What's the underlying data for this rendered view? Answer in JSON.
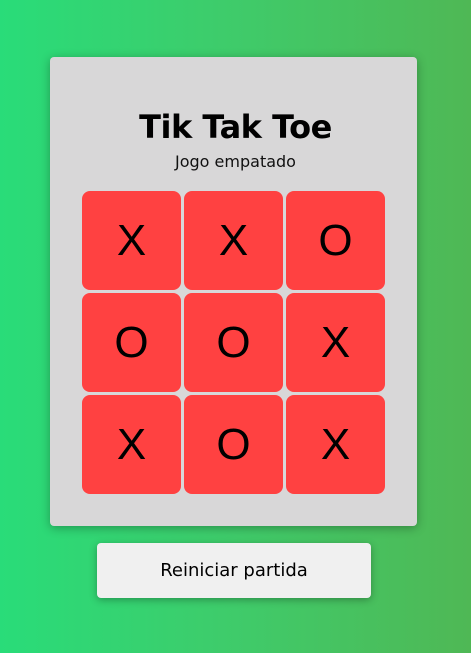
{
  "title": "Tik Tak Toe",
  "status": "Jogo empatado",
  "board": [
    "X",
    "X",
    "O",
    "O",
    "O",
    "X",
    "X",
    "O",
    "X"
  ],
  "restart_label": "Reiniciar partida",
  "colors": {
    "cell": "#ff4141",
    "card": "#d8d7d8",
    "background_start": "#29dc79",
    "background_end": "#4fb855"
  }
}
